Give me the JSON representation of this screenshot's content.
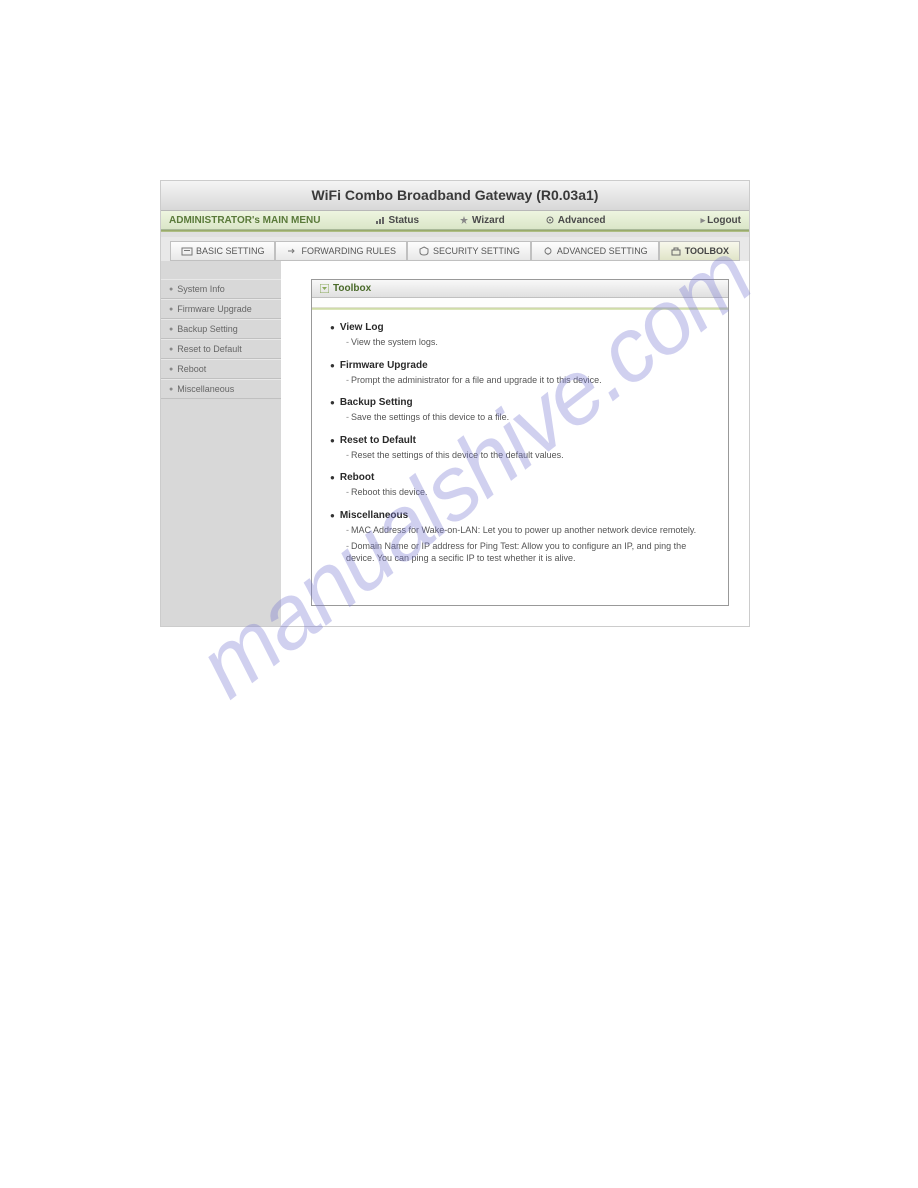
{
  "header": {
    "title": "WiFi Combo Broadband Gateway (R0.03a1)"
  },
  "menu": {
    "main_label": "ADMINISTRATOR's MAIN MENU",
    "items": [
      {
        "label": "Status"
      },
      {
        "label": "Wizard"
      },
      {
        "label": "Advanced"
      }
    ],
    "logout": "Logout"
  },
  "tabs": [
    {
      "label": "BASIC SETTING",
      "active": false
    },
    {
      "label": "FORWARDING RULES",
      "active": false
    },
    {
      "label": "SECURITY SETTING",
      "active": false
    },
    {
      "label": "ADVANCED SETTING",
      "active": false
    },
    {
      "label": "TOOLBOX",
      "active": true
    }
  ],
  "sidebar": {
    "items": [
      {
        "label": "System Info"
      },
      {
        "label": "Firmware Upgrade"
      },
      {
        "label": "Backup Setting"
      },
      {
        "label": "Reset to Default"
      },
      {
        "label": "Reboot"
      },
      {
        "label": "Miscellaneous"
      }
    ]
  },
  "panel": {
    "title": "Toolbox",
    "features": [
      {
        "title": "View Log",
        "descs": [
          "View the system logs."
        ]
      },
      {
        "title": "Firmware Upgrade",
        "descs": [
          "Prompt the administrator for a file and upgrade it to this device."
        ]
      },
      {
        "title": "Backup Setting",
        "descs": [
          "Save the settings of this device to a file."
        ]
      },
      {
        "title": "Reset to Default",
        "descs": [
          "Reset the settings of this device to the default values."
        ]
      },
      {
        "title": "Reboot",
        "descs": [
          "Reboot this device."
        ]
      },
      {
        "title": "Miscellaneous",
        "descs": [
          "MAC Address for Wake-on-LAN: Let you to power up another network device remotely.",
          "Domain Name or IP address for Ping Test: Allow you to configure an IP, and ping the device. You can ping a secific IP to test whether it is alive."
        ]
      }
    ]
  },
  "watermark": "manualshive.com"
}
